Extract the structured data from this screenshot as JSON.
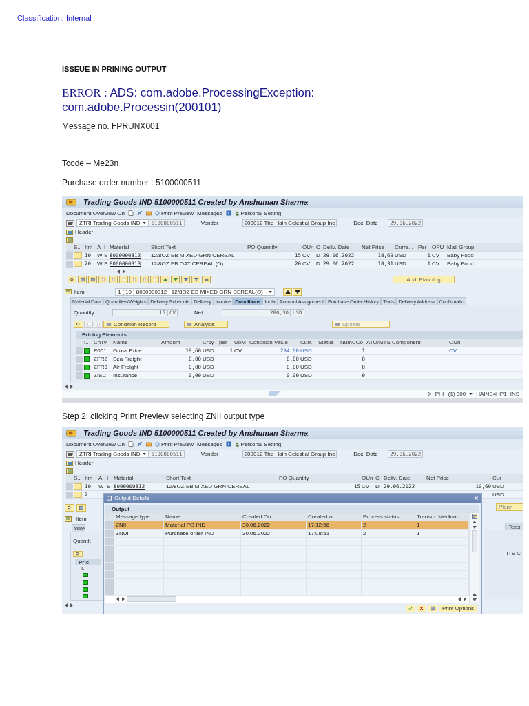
{
  "classification": "Classification: Internal",
  "heading": "ISSEUE IN PRINING OUTPUT",
  "error": {
    "label": "ERROR :",
    "text": "ADS: com.adobe.ProcessingException: com.adobe.Processin(200101)"
  },
  "message_no": "Message no. FPRUNX001",
  "tcode": "Tcode – Me23n",
  "po_number": "Purchase order number : 5100000511",
  "screenshot_1": {
    "title": "Trading Goods IND 5100000511 Created by Anshuman Sharma",
    "toolbar": {
      "overview": "Document Overview On",
      "print_preview": "Print Preview",
      "messages": "Messages",
      "personal_setting": "Personal Setting"
    },
    "doc_type": "ZTRI Trading Goods IND",
    "po": "5100000511",
    "vendor_label": "Vendor",
    "vendor": "200012 The Hain Celestial Group Inc",
    "date_label": "Doc. Date",
    "date": "29.06.2022",
    "header_label": "Header",
    "items": {
      "columns": [
        "S..",
        "Itm",
        "A",
        "I",
        "Material",
        "Short Text",
        "PO Quantity",
        "OUn",
        "C",
        "Deliv. Date",
        "Net Price",
        "Curre...",
        "Per",
        "OPU",
        "Matl Group"
      ],
      "rows": [
        {
          "itm": "10",
          "a": "W",
          "i": "S",
          "material": "8000000312",
          "short_text": "12/8OZ EB MIXED GRN CEREAL",
          "quantity": "15",
          "oun": "CV",
          "c": "D",
          "deliv_date": "29.06.2022",
          "net_price": "18,69",
          "currency": "USD",
          "per": "1",
          "opu": "CV",
          "matl_group": "Baby Food"
        },
        {
          "itm": "20",
          "a": "W",
          "i": "S",
          "material": "8000000313",
          "short_text": "12/8OZ EB OAT CEREAL (O)",
          "quantity": "20",
          "oun": "CV",
          "c": "D",
          "deliv_date": "29.06.2022",
          "net_price": "18,31",
          "currency": "USD",
          "per": "1",
          "opu": "CV",
          "matl_group": "Baby Food"
        }
      ]
    },
    "planning_button": "Addl Planning",
    "item_label": "Item",
    "item_value": "1 [ 10 ] 8000000312 , 12/8OZ EB MIXED GRN CEREAL(O)",
    "tabs": [
      {
        "label": "Material Data",
        "selected": false
      },
      {
        "label": "Quantities/Weights",
        "selected": false
      },
      {
        "label": "Delivery Schedule",
        "selected": false
      },
      {
        "label": "Delivery",
        "selected": false
      },
      {
        "label": "Invoice",
        "selected": false
      },
      {
        "label": "Conditions",
        "selected": true
      },
      {
        "label": "India",
        "selected": false
      },
      {
        "label": "Account Assignment",
        "selected": false
      },
      {
        "label": "Purchase Order History",
        "selected": false
      },
      {
        "label": "Texts",
        "selected": false
      },
      {
        "label": "Delivery Address",
        "selected": false
      },
      {
        "label": "Confirmatio",
        "selected": false
      }
    ],
    "quantity_label": "Quantity",
    "quantity": "15",
    "quantity_unit": "CV",
    "net_label": "Net",
    "net": "280,30",
    "net_currency": "USD",
    "buttons": [
      {
        "label": "Condition Record",
        "disabled": false
      },
      {
        "label": "Analysis",
        "disabled": false
      },
      {
        "label": "Update",
        "disabled": true
      }
    ],
    "pricing": {
      "title": "Pricing Elements",
      "columns": [
        "I..",
        "CnTy",
        "Name",
        "Amount",
        "Crcy",
        "per",
        "UoM",
        "Condition Value",
        "Curr.",
        "Status",
        "NumCCo",
        "ATO/MTS Component",
        "OUn"
      ],
      "rows": [
        {
          "cnty": "P001",
          "name": "Gross Price",
          "amount": "19,60",
          "crcy": "USD",
          "per": "1",
          "uom": "CV",
          "value": "294,00",
          "curr": "USD",
          "numcco": "1",
          "oun": "CV",
          "emphasized": true
        },
        {
          "cnty": "ZFR2",
          "name": "Sea Freight",
          "amount": "0,00",
          "crcy": "USD",
          "value": "0,00",
          "curr": "USD",
          "numcco": "0",
          "emphasized": false
        },
        {
          "cnty": "ZFR3",
          "name": "Air Freight",
          "amount": "0,00",
          "crcy": "USD",
          "value": "0,00",
          "curr": "USD",
          "numcco": "0",
          "emphasized": false
        },
        {
          "cnty": "ZISC",
          "name": "Insurance",
          "amount": "0,00",
          "crcy": "USD",
          "value": "0,00",
          "curr": "USD",
          "numcco": "0",
          "emphasized": false
        }
      ]
    },
    "status": {
      "system": "PHH (1) 300",
      "server": "HAINS4HP1",
      "mode": "INS"
    }
  },
  "step_2": "Step 2: clicking Print Preview selecting ZNII output type",
  "screenshot_2": {
    "title": "Trading Goods IND 5100000511 Created by Anshuman Sharma",
    "toolbar": {
      "overview": "Document Overview On",
      "print_preview": "Print Preview",
      "messages": "Messages",
      "personal_setting": "Personal Setting"
    },
    "doc_type": "ZTRI Trading Goods IND",
    "po": "5100000511",
    "vendor_label": "Vendor",
    "vendor": "200012 The Hain Celestial Group Inc",
    "date_label": "Doc. Date",
    "date": "29.06.2022",
    "header_label": "Header",
    "items": {
      "columns": [
        "S..",
        "Itm",
        "A",
        "I",
        "Material",
        "Short Text",
        "PO Quantity",
        "OUn",
        "C",
        "Deliv. Date",
        "Net Price",
        "Cur"
      ],
      "rows": [
        {
          "itm": "10",
          "a": "W",
          "i": "S",
          "material": "8000000312",
          "short_text": "12/8OZ EB MIXED GRN CEREAL",
          "quantity": "15",
          "oun": "CV",
          "c": "D",
          "deliv_date": "29.06.2022",
          "net_price": "10,69",
          "currency": "USD"
        },
        {
          "itm": "2",
          "currency": "USD"
        }
      ]
    },
    "behind": {
      "planning": "Plann",
      "item_label": "Item",
      "tab": "Mate",
      "texts_tab": "Texts",
      "quantity": "Quantit",
      "pricing": "Pric",
      "column": "I.",
      "column_right": "ITS C"
    },
    "dialog": {
      "title": "Output Details",
      "section": "Output",
      "columns": [
        "Message type",
        "Name",
        "Created On",
        "Created at",
        "Process.status",
        "Transm. Medium"
      ],
      "rows": [
        {
          "cells": [
            "ZNII",
            "Material PO IND",
            "30.06.2022",
            "17:12:56",
            "2",
            "1"
          ],
          "selected": true
        },
        {
          "cells": [
            "ZNUI",
            "Purchase order IND",
            "30.06.2022",
            "17:08:51",
            "2",
            "1"
          ],
          "selected": false
        }
      ],
      "button": "Print Options"
    }
  }
}
